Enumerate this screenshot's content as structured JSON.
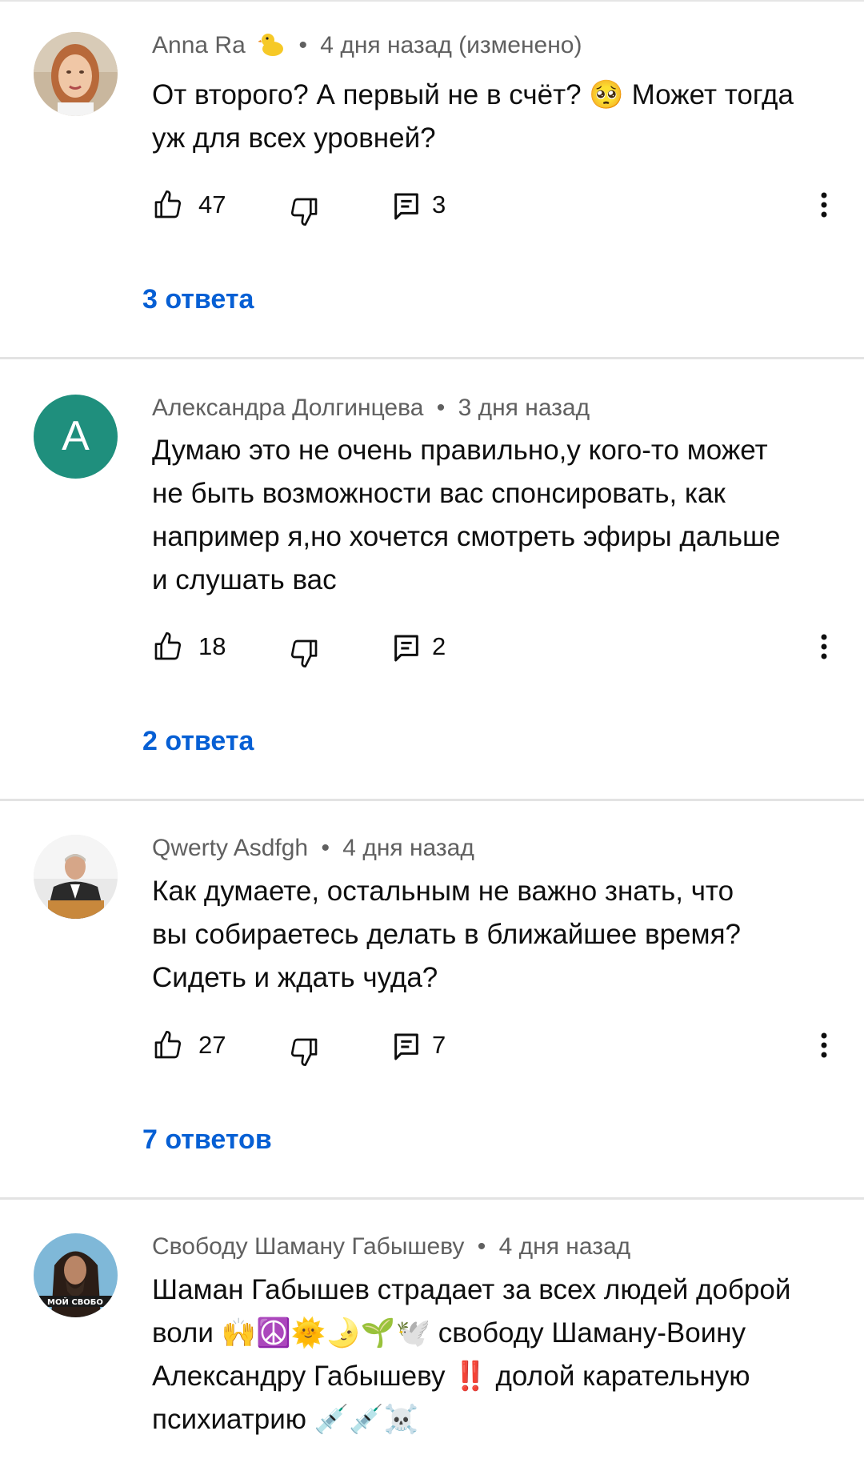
{
  "comments": [
    {
      "author": "Anna Ra",
      "time": "4 дня назад (изменено)",
      "text_lines": [
        "От второго? А первый не в счёт? 🥺 Может тогда",
        "уж для всех уровней?"
      ],
      "likes": "47",
      "replies_count": "3",
      "replies_label": "3 ответа"
    },
    {
      "author": "Александра Долгинцева",
      "avatar_letter": "A",
      "time": "3 дня назад",
      "text_lines": [
        "Думаю это не очень правильно,у кого-то может",
        "не быть возможности вас спонсировать, как",
        "например я,но хочется смотреть эфиры дальше",
        "и слушать вас"
      ],
      "likes": "18",
      "replies_count": "2",
      "replies_label": "2 ответа"
    },
    {
      "author": "Qwerty Asdfgh",
      "time": "4 дня назад",
      "text_lines": [
        "Как думаете, остальным не важно знать, что",
        "вы собираетесь делать в ближайшее время?",
        "Сидеть и ждать чуда?"
      ],
      "likes": "27",
      "replies_count": "7",
      "replies_label": "7 ответов"
    },
    {
      "author": "Свободу Шаману Габышеву",
      "time": "4 дня назад",
      "text_lines": [
        "Шаман Габышев страдает за всех людей доброй",
        "воли 🙌☮️🌞🌛🌱🕊️ свободу Шаману-Воину",
        "Александру Габышеву ‼️ долой карательную",
        "психиатрию 💉💉☠️"
      ],
      "avatar_text": "МОЙ СВОБО"
    }
  ],
  "separator": "•",
  "colors": {
    "link": "#065fd4",
    "meta": "#606060",
    "divider": "#e3e3e3"
  },
  "icons": [
    "like-icon",
    "dislike-icon",
    "reply-icon",
    "more-vert-icon",
    "duck-badge-icon"
  ]
}
